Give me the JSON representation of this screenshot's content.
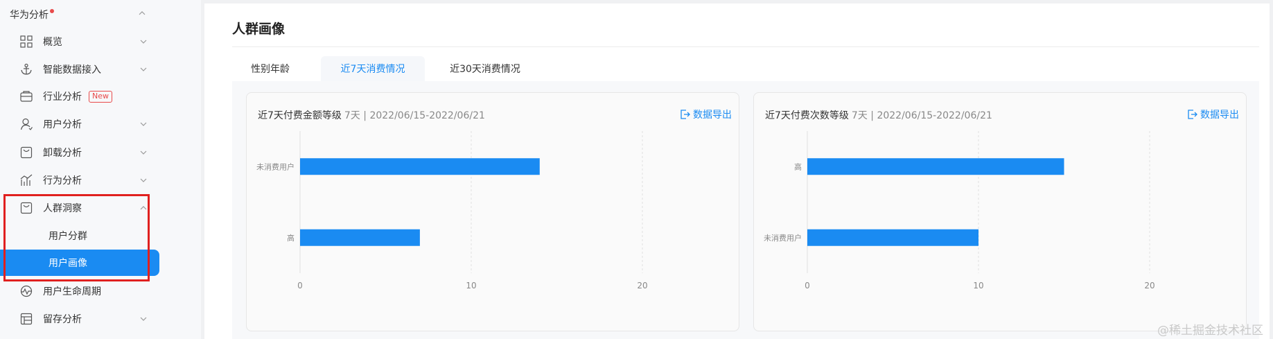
{
  "sidebar": {
    "top_label": "华为分析",
    "items": [
      {
        "label": "概览",
        "icon": "grid-icon"
      },
      {
        "label": "智能数据接入",
        "icon": "anchor-icon"
      },
      {
        "label": "行业分析",
        "icon": "industry-icon",
        "badge": "New"
      },
      {
        "label": "用户分析",
        "icon": "user-icon"
      },
      {
        "label": "卸载分析",
        "icon": "uninstall-icon"
      },
      {
        "label": "行为分析",
        "icon": "bar-chart-icon"
      },
      {
        "label": "人群洞察",
        "icon": "crowd-icon"
      },
      {
        "label": "用户生命周期",
        "icon": "pulse-icon"
      },
      {
        "label": "留存分析",
        "icon": "table-icon"
      }
    ],
    "sub_items": [
      "用户分群",
      "用户画像"
    ],
    "active_sub": "用户画像"
  },
  "main": {
    "title": "人群画像",
    "tabs": [
      "性别年龄",
      "近7天消费情况",
      "近30天消费情况"
    ],
    "active_tab": "近7天消费情况"
  },
  "cards": [
    {
      "title": "近7天付费金额等级",
      "subtitle": "7天 | 2022/06/15-2022/06/21",
      "export_label": "数据导出"
    },
    {
      "title": "近7天付费次数等级",
      "subtitle": "7天 | 2022/06/15-2022/06/21",
      "export_label": "数据导出"
    }
  ],
  "chart_data": [
    {
      "type": "bar",
      "orientation": "horizontal",
      "categories": [
        "未消费用户",
        "高"
      ],
      "values": [
        14,
        7
      ],
      "xlim": [
        0,
        20
      ],
      "xticks": [
        0,
        10,
        20
      ],
      "color": "#1a8bf2"
    },
    {
      "type": "bar",
      "orientation": "horizontal",
      "categories": [
        "高",
        "未消费用户"
      ],
      "values": [
        15,
        10
      ],
      "xlim": [
        0,
        20
      ],
      "xticks": [
        0,
        10,
        20
      ],
      "color": "#1a8bf2"
    }
  ],
  "watermark": "@稀土掘金技术社区",
  "colors": {
    "accent": "#1a8bf2",
    "highlight_border": "#e0201f",
    "badge": "#e84a4a"
  }
}
